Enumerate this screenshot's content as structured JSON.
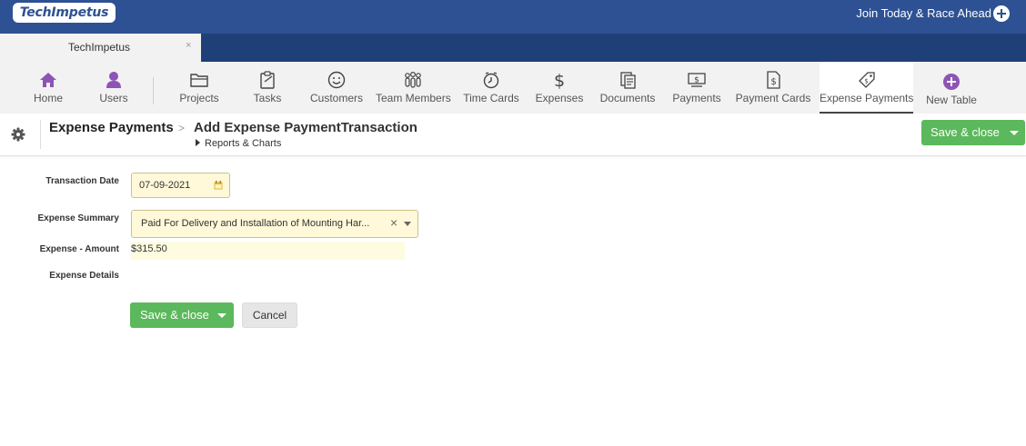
{
  "header": {
    "logo_text": "TechImpetus",
    "join_label": "Join Today & Race Ahead",
    "join_icon": "plus-circle-icon",
    "colors": {
      "primary": "#2d5193",
      "tabbar": "#1f3f78",
      "accent_green": "#5cb85c",
      "field_bg": "#fff9d9",
      "nav_icon_purple": "#8e54b5"
    }
  },
  "tab": {
    "label": "TechImpetus",
    "close": "×"
  },
  "nav": {
    "items": [
      {
        "label": "Home",
        "icon": "home-icon"
      },
      {
        "label": "Users",
        "icon": "user-icon"
      },
      {
        "label": "Projects",
        "icon": "folder-icon"
      },
      {
        "label": "Tasks",
        "icon": "clipboard-icon"
      },
      {
        "label": "Customers",
        "icon": "smiley-icon"
      },
      {
        "label": "Team Members",
        "icon": "team-icon"
      },
      {
        "label": "Time Cards",
        "icon": "clock-icon"
      },
      {
        "label": "Expenses",
        "icon": "dollar-icon"
      },
      {
        "label": "Documents",
        "icon": "documents-icon"
      },
      {
        "label": "Payments",
        "icon": "payment-icon"
      },
      {
        "label": "Payment Cards",
        "icon": "payment-card-icon"
      },
      {
        "label": "Expense Payments",
        "icon": "tag-icon",
        "active": true
      },
      {
        "label": "New Table",
        "icon": "plus-circle-icon"
      }
    ]
  },
  "titlebar": {
    "breadcrumb": "Expense Payments",
    "separator": ">",
    "title": "Add Expense PaymentTransaction",
    "sub_link": "Reports & Charts",
    "save_label": "Save & close"
  },
  "form": {
    "transaction_date": {
      "label": "Transaction Date",
      "value": "07-09-2021"
    },
    "expense_summary": {
      "label": "Expense Summary",
      "value": "Paid For Delivery and Installation of Mounting Har...",
      "clear": "×"
    },
    "expense_amount": {
      "label": "Expense - Amount",
      "value": "$315.50"
    },
    "expense_details": {
      "label": "Expense Details"
    },
    "save_label": "Save & close",
    "cancel_label": "Cancel"
  }
}
